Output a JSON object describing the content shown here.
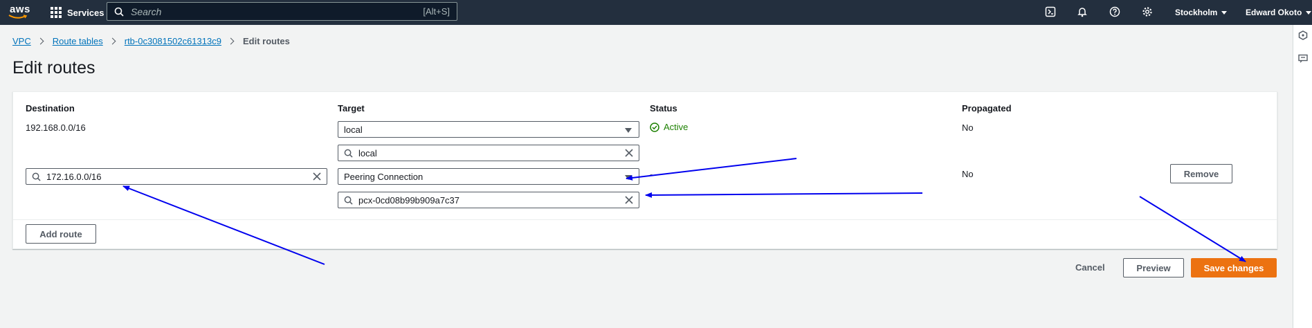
{
  "nav": {
    "logo": "aws",
    "services_label": "Services",
    "search_placeholder": "Search",
    "search_shortcut": "[Alt+S]",
    "region": "Stockholm",
    "user": "Edward Okoto"
  },
  "breadcrumb": {
    "items": [
      "VPC",
      "Route tables",
      "rtb-0c3081502c61313c9"
    ],
    "current": "Edit routes"
  },
  "page_title": "Edit routes",
  "table": {
    "columns": [
      "Destination",
      "Target",
      "Status",
      "Propagated"
    ],
    "row1": {
      "destination": "192.168.0.0/16",
      "target_type": "local",
      "target_value": "local",
      "status": "Active",
      "propagated": "No"
    },
    "row2": {
      "destination": "172.16.0.0/16",
      "target_type": "Peering Connection",
      "target_value": "pcx-0cd08b99b909a7c37",
      "status": "-",
      "propagated": "No",
      "remove_label": "Remove"
    },
    "add_route_label": "Add route"
  },
  "footer": {
    "cancel_label": "Cancel",
    "preview_label": "Preview",
    "save_label": "Save changes"
  },
  "colors": {
    "nav_bg": "#232f3e",
    "link": "#0073bb",
    "primary": "#ec7211",
    "success": "#1d8102",
    "annotation": "#0000ee"
  },
  "icons": [
    "services-grid-icon",
    "search-icon",
    "cloudshell-icon",
    "bell-icon",
    "help-icon",
    "gear-icon",
    "clear-icon",
    "status-success-icon",
    "dropdown-caret-icon"
  ]
}
